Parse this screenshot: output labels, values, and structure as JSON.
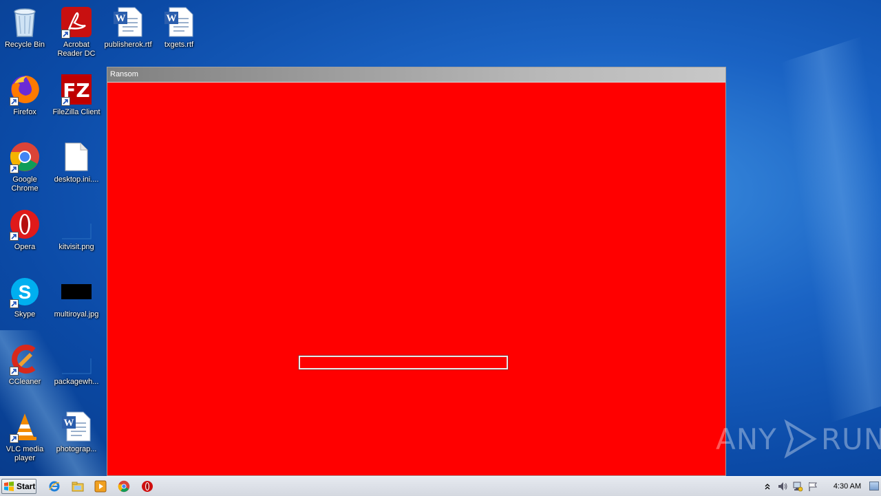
{
  "desktop": {
    "icons": [
      {
        "label": "Recycle Bin",
        "icon": "recycle-bin-icon"
      },
      {
        "label": "Acrobat Reader DC",
        "icon": "acrobat-icon"
      },
      {
        "label": "publisherok.rtf",
        "icon": "word-doc-icon"
      },
      {
        "label": "txgets.rtf",
        "icon": "word-doc-icon"
      },
      {
        "label": "Firefox",
        "icon": "firefox-icon"
      },
      {
        "label": "FileZilla Client",
        "icon": "filezilla-icon"
      },
      {
        "label": "Google Chrome",
        "icon": "chrome-icon"
      },
      {
        "label": "desktop.ini....",
        "icon": "blank-file-icon"
      },
      {
        "label": "Opera",
        "icon": "opera-icon"
      },
      {
        "label": "kitvisit.png",
        "icon": "image-file-icon"
      },
      {
        "label": "Skype",
        "icon": "skype-icon"
      },
      {
        "label": "multiroyal.jpg",
        "icon": "image-file-icon"
      },
      {
        "label": "CCleaner",
        "icon": "ccleaner-icon"
      },
      {
        "label": "packagewh...",
        "icon": "image-file-icon"
      },
      {
        "label": "VLC media player",
        "icon": "vlc-icon"
      },
      {
        "label": "photograp...",
        "icon": "word-doc-icon"
      }
    ]
  },
  "ransom_window": {
    "title": "Ransom",
    "background_color": "#ff0000",
    "input_value": ""
  },
  "watermark": {
    "text": "ANY RUN"
  },
  "taskbar": {
    "start_label": "Start",
    "apps": [
      "internet-explorer-icon",
      "windows-explorer-icon",
      "media-player-icon",
      "chrome-icon",
      "opera-icon"
    ],
    "clock": "4:30 AM"
  }
}
